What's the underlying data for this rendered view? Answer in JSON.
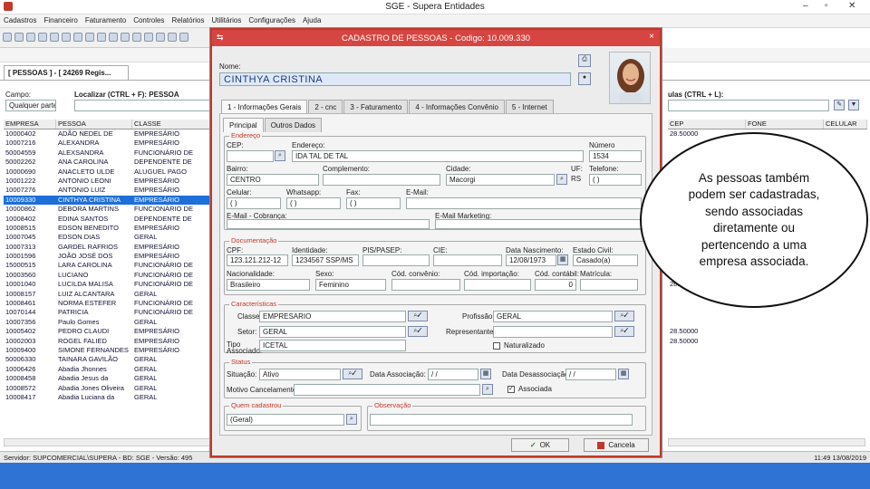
{
  "window": {
    "title": "SGE - Supera Entidades"
  },
  "menubar": {
    "items": [
      "Cadastros",
      "Financeiro",
      "Faturamento",
      "Controles",
      "Relatórios",
      "Utilitários",
      "Configurações",
      "Ajuda"
    ]
  },
  "main": {
    "tab_label": "[ PESSOAS ] - [ 24269 Regis...",
    "filter": {
      "field_label": "Campo:",
      "field_value": "Qualquer parte",
      "search_label": "Localizar (CTRL + F): PESSOA",
      "right_label": "ulas (CTRL + L):"
    },
    "grid": {
      "columns": [
        "EMPRESA",
        "PESSOA",
        "CLASSE"
      ],
      "rows": [
        {
          "empresa": "10000402",
          "pessoa": "ADÃO NEDEL DE",
          "classe": "EMPRESÁRIO"
        },
        {
          "empresa": "10007216",
          "pessoa": "ALEXANDRA",
          "classe": "EMPRESÁRIO"
        },
        {
          "empresa": "50004559",
          "pessoa": "ALEXSANDRA",
          "classe": "FUNCIONÁRIO DE"
        },
        {
          "empresa": "50002262",
          "pessoa": "ANA CAROLINA",
          "classe": "DEPENDENTE DE"
        },
        {
          "empresa": "10000690",
          "pessoa": "ANACLETO ULDE",
          "classe": "ALUGUEL PAGO"
        },
        {
          "empresa": "10001222",
          "pessoa": "ANTONIO LEONI",
          "classe": "EMPRESÁRIO"
        },
        {
          "empresa": "10007276",
          "pessoa": "ANTONIO LUIZ",
          "classe": "EMPRESÁRIO"
        },
        {
          "empresa": "10009330",
          "pessoa": "CINTHYA CRISTINA",
          "classe": "EMPRESÁRIO"
        },
        {
          "empresa": "10000862",
          "pessoa": "DEBORA MARTINS",
          "classe": "FUNCIONÁRIO DE"
        },
        {
          "empresa": "10008402",
          "pessoa": "EDINA SANTOS",
          "classe": "DEPENDENTE DE"
        },
        {
          "empresa": "10008515",
          "pessoa": "EDSON BENEDITO",
          "classe": "EMPRESÁRIO"
        },
        {
          "empresa": "10007045",
          "pessoa": "EDSON DIAS",
          "classe": "GERAL"
        },
        {
          "empresa": "10007313",
          "pessoa": "GARDEL RAFRIOS",
          "classe": "EMPRESÁRIO"
        },
        {
          "empresa": "10001596",
          "pessoa": "JOÃO JOSÉ DOS",
          "classe": "EMPRESÁRIO"
        },
        {
          "empresa": "15000515",
          "pessoa": "LARA CAROLINA",
          "classe": "FUNCIONÁRIO DE"
        },
        {
          "empresa": "10003560",
          "pessoa": "LUCIANO",
          "classe": "FUNCIONÁRIO DE"
        },
        {
          "empresa": "10001040",
          "pessoa": "LUCILDA MALISA",
          "classe": "FUNCIONÁRIO DE"
        },
        {
          "empresa": "10008157",
          "pessoa": "LUIZ ALCANTARA",
          "classe": "GERAL"
        },
        {
          "empresa": "10008461",
          "pessoa": "NORMA ESTEFER",
          "classe": "FUNCIONÁRIO DE"
        },
        {
          "empresa": "10070144",
          "pessoa": "PATRICIA",
          "classe": "FUNCIONÁRIO DE"
        },
        {
          "empresa": "10007356",
          "pessoa": "Paulo Gomes",
          "classe": "GERAL"
        },
        {
          "empresa": "10005402",
          "pessoa": "PEDRO CLAUDI",
          "classe": "EMPRESÁRIO"
        },
        {
          "empresa": "10002003",
          "pessoa": "ROGEL FALIED",
          "classe": "EMPRESÁRIO"
        },
        {
          "empresa": "10009400",
          "pessoa": "SIMONE FERNANDES",
          "classe": "EMPRESÁRIO"
        },
        {
          "empresa": "50006330",
          "pessoa": "TAINARA GAVILÃO",
          "classe": "GERAL"
        },
        {
          "empresa": "10006426",
          "pessoa": "Abadia Jhonnes",
          "classe": "GERAL"
        },
        {
          "empresa": "10008458",
          "pessoa": "Abadia Jesus da",
          "classe": "GERAL"
        },
        {
          "empresa": "10008572",
          "pessoa": "Abadia Jones Oliveira",
          "classe": "GERAL"
        },
        {
          "empresa": "10008417",
          "pessoa": "Abadia Luciana da",
          "classe": "GERAL"
        }
      ],
      "selected_index": 7
    },
    "right_grid": {
      "columns": [
        "CEP",
        "FONE",
        "CELULAR"
      ],
      "rows": [
        {
          "cep": "28.50000",
          "fone": "",
          "celular": ""
        },
        {
          "cep": "",
          "fone": "",
          "celular": ""
        },
        {
          "cep": "",
          "fone": "",
          "celular": ""
        },
        {
          "cep": "",
          "fone": "",
          "celular": ""
        },
        {
          "cep": "",
          "fone": "",
          "celular": ""
        },
        {
          "cep": "",
          "fone": "",
          "celular": ""
        },
        {
          "cep": "",
          "fone": "",
          "celular": ""
        },
        {
          "cep": "",
          "fone": "",
          "celular": ""
        },
        {
          "cep": "",
          "fone": "",
          "celular": ""
        },
        {
          "cep": "",
          "fone": "",
          "celular": ""
        },
        {
          "cep": "",
          "fone": "",
          "celular": ""
        },
        {
          "cep": "",
          "fone": "",
          "celular": ""
        },
        {
          "cep": "",
          "fone": "",
          "celular": ""
        },
        {
          "cep": "",
          "fone": "",
          "celular": ""
        },
        {
          "cep": "",
          "fone": "",
          "celular": ""
        },
        {
          "cep": "",
          "fone": "",
          "celular": ""
        },
        {
          "cep": "28.50000",
          "fone": "",
          "celular": ""
        },
        {
          "cep": "",
          "fone": "",
          "celular": ""
        },
        {
          "cep": "",
          "fone": "",
          "celular": ""
        },
        {
          "cep": "",
          "fone": "",
          "celular": ""
        },
        {
          "cep": "",
          "fone": "",
          "celular": ""
        },
        {
          "cep": "28.50000",
          "fone": "",
          "celular": ""
        },
        {
          "cep": "28.50000",
          "fone": "",
          "celular": ""
        }
      ]
    }
  },
  "dialog": {
    "title": "CADASTRO DE PESSOAS - Codigo: 10.009.330",
    "name_label": "Nome:",
    "name_value": "CINTHYA CRISTINA",
    "tabs": [
      "1 - Informações Gerais",
      "2 - cnc",
      "3 - Faturamento",
      "4 - Informações Convênio",
      "5 - Internet"
    ],
    "subtabs": [
      "Principal",
      "Outros Dados"
    ],
    "endereco": {
      "legend": "Endereço",
      "cep_label": "CEP:",
      "cep_value": "",
      "endereco_label": "Endereço:",
      "endereco_value": "IDA TAL DE TAL",
      "numero_label": "Número",
      "numero_value": "1534",
      "bairro_label": "Bairro:",
      "bairro_value": "CENTRO",
      "complemento_label": "Complemento:",
      "complemento_value": "",
      "cidade_label": "Cidade:",
      "cidade_value": "Macorgi",
      "uf_label": "UF:",
      "uf_value": "RS",
      "telefone_label": "Telefone:",
      "telefone_value": "( )",
      "celular_label": "Celular:",
      "celular_value": "( )",
      "whatsapp_label": "Whatsapp:",
      "whatsapp_value": "( )",
      "fax_label": "Fax:",
      "fax_value": "( )",
      "email_label": "E-Mail:",
      "email_value": "",
      "email_cobranca_label": "E-Mail - Cobrança:",
      "email_cobranca_value": "",
      "email_marketing_label": "E-Mail Marketing:",
      "email_marketing_value": ""
    },
    "documentacao": {
      "legend": "Documentação",
      "cpf_label": "CPF:",
      "cpf_value": "123.121.212-12",
      "identidade_label": "Identidade:",
      "identidade_value": "1234567 SSP/MS",
      "pis_label": "PIS/PASEP:",
      "pis_value": "",
      "cie_label": "CIE:",
      "cie_value": "",
      "nascimento_label": "Data Nascimento:",
      "nascimento_value": "12/08/1973",
      "estado_civil_label": "Estado Civil:",
      "estado_civil_value": "Casado(a)",
      "nacionalidade_label": "Nacionalidade:",
      "nacionalidade_value": "Brasileiro",
      "sexo_label": "Sexo:",
      "sexo_value": "Feminino",
      "cod_convenio_label": "Cód. convênio:",
      "cod_convenio_value": "",
      "cod_importacao_label": "Cód. importação:",
      "cod_importacao_value": "",
      "cod_contabil_label": "Cód. contábil:",
      "cod_contabil_value": "0",
      "matricula_label": "Matrícula:",
      "matricula_value": ""
    },
    "caracteristicas": {
      "legend": "Características",
      "classe_label": "Classe:",
      "classe_value": "EMPRESARIO",
      "setor_label": "Setor:",
      "setor_value": "GERAL",
      "tipo_associado_label": "Tipo Associado:",
      "tipo_associado_value": "ICETAL",
      "profissao_label": "Profissão:",
      "profissao_value": "GERAL",
      "representante_label": "Representante:",
      "representante_value": "",
      "naturalizado_label": "Naturalizado"
    },
    "status": {
      "legend": "Status",
      "situacao_label": "Situação:",
      "situacao_value": "Ativo",
      "data_associacao_label": "Data Associação:",
      "data_associacao_value": "/ /",
      "data_desassociacao_label": "Data Desassociação:",
      "data_desassociacao_value": "/ /",
      "motivo_label": "Motivo Cancelamento:",
      "motivo_value": "",
      "associada_label": "Associada"
    },
    "quem_cadastrou": {
      "legend": "Quem cadastrou",
      "value": "(Geral)"
    },
    "observacao": {
      "legend": "Observação",
      "value": ""
    },
    "ok_label": "OK",
    "cancel_label": "Cancela"
  },
  "statusbar": {
    "text": "Servidor: SUPCOMERCIAL\\SUPERA - BD: SGE - Versão: 495",
    "clock": "11:49  13/08/2019"
  },
  "callout": {
    "text": "As pessoas também podem ser cadastradas, sendo associadas diretamente ou pertencendo a uma empresa associada."
  }
}
